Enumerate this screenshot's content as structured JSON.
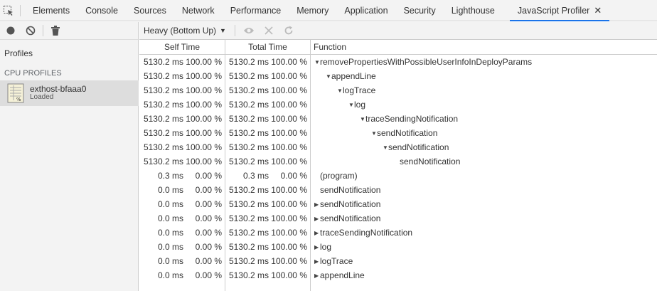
{
  "tabs": [
    {
      "label": "Elements"
    },
    {
      "label": "Console"
    },
    {
      "label": "Sources"
    },
    {
      "label": "Network"
    },
    {
      "label": "Performance"
    },
    {
      "label": "Memory"
    },
    {
      "label": "Application"
    },
    {
      "label": "Security"
    },
    {
      "label": "Lighthouse"
    },
    {
      "label": "JavaScript Profiler",
      "active": true
    }
  ],
  "colors": {
    "accent": "#1a73e8",
    "panel_bg": "#f3f3f3",
    "selected_bg": "#dddddd"
  },
  "sidebar": {
    "profiles_title": "Profiles",
    "cpu_title": "CPU PROFILES",
    "profile": {
      "name": "exthost-bfaaa0",
      "status": "Loaded"
    }
  },
  "toolbar": {
    "view_mode": "Heavy (Bottom Up)"
  },
  "table": {
    "headers": {
      "self": "Self Time",
      "total": "Total Time",
      "function": "Function"
    },
    "rows": [
      {
        "self_ms": "5130.2 ms",
        "self_pct": "100.00 %",
        "total_ms": "5130.2 ms",
        "total_pct": "100.00 %",
        "fn": "removePropertiesWithPossibleUserInfoInDeployParams",
        "depth": 0,
        "toggle": "expanded"
      },
      {
        "self_ms": "5130.2 ms",
        "self_pct": "100.00 %",
        "total_ms": "5130.2 ms",
        "total_pct": "100.00 %",
        "fn": "appendLine",
        "depth": 1,
        "toggle": "expanded"
      },
      {
        "self_ms": "5130.2 ms",
        "self_pct": "100.00 %",
        "total_ms": "5130.2 ms",
        "total_pct": "100.00 %",
        "fn": "logTrace",
        "depth": 2,
        "toggle": "expanded"
      },
      {
        "self_ms": "5130.2 ms",
        "self_pct": "100.00 %",
        "total_ms": "5130.2 ms",
        "total_pct": "100.00 %",
        "fn": "log",
        "depth": 3,
        "toggle": "expanded"
      },
      {
        "self_ms": "5130.2 ms",
        "self_pct": "100.00 %",
        "total_ms": "5130.2 ms",
        "total_pct": "100.00 %",
        "fn": "traceSendingNotification",
        "depth": 4,
        "toggle": "expanded"
      },
      {
        "self_ms": "5130.2 ms",
        "self_pct": "100.00 %",
        "total_ms": "5130.2 ms",
        "total_pct": "100.00 %",
        "fn": "sendNotification",
        "depth": 5,
        "toggle": "expanded"
      },
      {
        "self_ms": "5130.2 ms",
        "self_pct": "100.00 %",
        "total_ms": "5130.2 ms",
        "total_pct": "100.00 %",
        "fn": "sendNotification",
        "depth": 6,
        "toggle": "expanded"
      },
      {
        "self_ms": "5130.2 ms",
        "self_pct": "100.00 %",
        "total_ms": "5130.2 ms",
        "total_pct": "100.00 %",
        "fn": "sendNotification",
        "depth": 7,
        "toggle": "none"
      },
      {
        "self_ms": "0.3 ms",
        "self_pct": "0.00 %",
        "total_ms": "0.3 ms",
        "total_pct": "0.00 %",
        "fn": "(program)",
        "depth": 0,
        "toggle": "none"
      },
      {
        "self_ms": "0.0 ms",
        "self_pct": "0.00 %",
        "total_ms": "5130.2 ms",
        "total_pct": "100.00 %",
        "fn": "sendNotification",
        "depth": 0,
        "toggle": "none"
      },
      {
        "self_ms": "0.0 ms",
        "self_pct": "0.00 %",
        "total_ms": "5130.2 ms",
        "total_pct": "100.00 %",
        "fn": "sendNotification",
        "depth": 0,
        "toggle": "collapsed"
      },
      {
        "self_ms": "0.0 ms",
        "self_pct": "0.00 %",
        "total_ms": "5130.2 ms",
        "total_pct": "100.00 %",
        "fn": "sendNotification",
        "depth": 0,
        "toggle": "collapsed"
      },
      {
        "self_ms": "0.0 ms",
        "self_pct": "0.00 %",
        "total_ms": "5130.2 ms",
        "total_pct": "100.00 %",
        "fn": "traceSendingNotification",
        "depth": 0,
        "toggle": "collapsed"
      },
      {
        "self_ms": "0.0 ms",
        "self_pct": "0.00 %",
        "total_ms": "5130.2 ms",
        "total_pct": "100.00 %",
        "fn": "log",
        "depth": 0,
        "toggle": "collapsed"
      },
      {
        "self_ms": "0.0 ms",
        "self_pct": "0.00 %",
        "total_ms": "5130.2 ms",
        "total_pct": "100.00 %",
        "fn": "logTrace",
        "depth": 0,
        "toggle": "collapsed"
      },
      {
        "self_ms": "0.0 ms",
        "self_pct": "0.00 %",
        "total_ms": "5130.2 ms",
        "total_pct": "100.00 %",
        "fn": "appendLine",
        "depth": 0,
        "toggle": "collapsed"
      }
    ]
  }
}
